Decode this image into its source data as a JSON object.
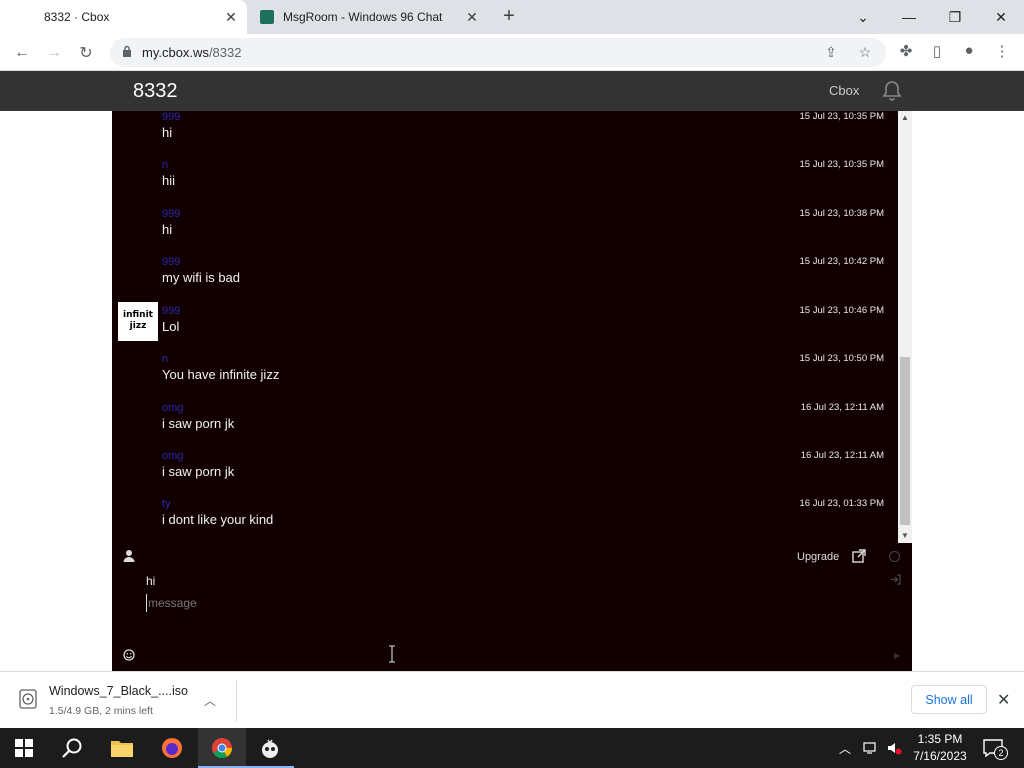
{
  "browser": {
    "tabs": [
      {
        "title": "8332 · Cbox",
        "active": true
      },
      {
        "title": "MsgRoom - Windows 96 Chat",
        "active": false
      }
    ],
    "url_host": "my.cbox.ws",
    "url_path": "/8332"
  },
  "cbox": {
    "title": "8332",
    "brand": "Cbox",
    "messages": [
      {
        "author": "999",
        "text": "hi",
        "time": "15 Jul 23, 10:35 PM"
      },
      {
        "author": "n",
        "text": "hii",
        "time": "15 Jul 23, 10:35 PM"
      },
      {
        "author": "999",
        "text": "hi",
        "time": "15 Jul 23, 10:38 PM"
      },
      {
        "author": "999",
        "text": "my wifi is bad",
        "time": "15 Jul 23, 10:42 PM"
      },
      {
        "author": "999",
        "text": "Lol",
        "time": "15 Jul 23, 10:46 PM"
      },
      {
        "author": "n",
        "text": "You have infinite jizz",
        "time": "15 Jul 23, 10:50 PM"
      },
      {
        "author": "omg",
        "text": "i saw porn jk",
        "time": "16 Jul 23, 12:11 AM"
      },
      {
        "author": "omg",
        "text": "i saw porn jk",
        "time": "16 Jul 23, 12:11 AM"
      },
      {
        "author": "ty",
        "text": "i dont like your kind",
        "time": "16 Jul 23, 01:33 PM"
      }
    ],
    "avatar_text": [
      "infinit",
      "jizz"
    ],
    "upgrade_label": "Upgrade",
    "name_value": "hi",
    "message_placeholder": "message"
  },
  "download": {
    "filename": "Windows_7_Black_....iso",
    "status": "1.5/4.9 GB, 2 mins left",
    "show_all": "Show all"
  },
  "taskbar": {
    "time": "1:35 PM",
    "date": "7/16/2023",
    "notification_count": "2"
  },
  "colors": {
    "chat_bg": "#120000",
    "author": "#2a2aa8",
    "header": "#333333"
  }
}
